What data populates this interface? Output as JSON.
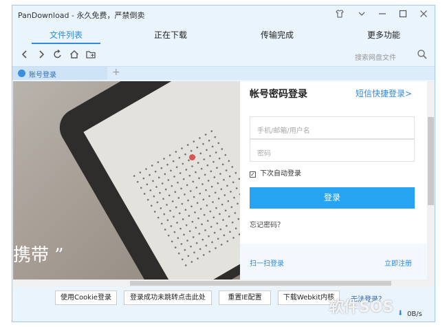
{
  "window": {
    "title": "PanDownload - 永久免费，严禁倒卖",
    "controls": [
      "shirt-icon",
      "chevron-down-icon",
      "minimize-icon",
      "maximize-icon",
      "close-icon"
    ]
  },
  "tabs": [
    {
      "label": "文件列表",
      "active": true
    },
    {
      "label": "正在下载",
      "active": false
    },
    {
      "label": "传输完成",
      "active": false
    },
    {
      "label": "更多功能",
      "active": false
    }
  ],
  "navbar": {
    "icons": [
      "back-icon",
      "forward-icon",
      "refresh-icon",
      "home-icon",
      "new-folder-icon"
    ],
    "search_placeholder": "搜索网盘文件"
  },
  "account_tab": {
    "label": "账号登录"
  },
  "photo": {
    "caption": "携带 ”"
  },
  "login": {
    "title": "帐号密码登录",
    "sms_link": "短信快捷登录>",
    "username_placeholder": "手机/邮箱/用户名",
    "password_placeholder": "密码",
    "remember_label": "下次自动登录",
    "remember_checked": true,
    "submit_label": "登录",
    "forgot_label": "忘记密码？",
    "scan_label": "扫一扫登录",
    "register_label": "立即注册"
  },
  "bottom_buttons": [
    "使用Cookie登录",
    "登录成功未跳转点击此处",
    "重置IE配置",
    "下载Webkit内核"
  ],
  "bottom_link": "无法登录？",
  "status": {
    "speed": "0B/s"
  },
  "watermark": "软件SOS",
  "colors": {
    "accent": "#2d8ae0",
    "button": "#26a4f2",
    "chrome": "#eaf4fd"
  }
}
